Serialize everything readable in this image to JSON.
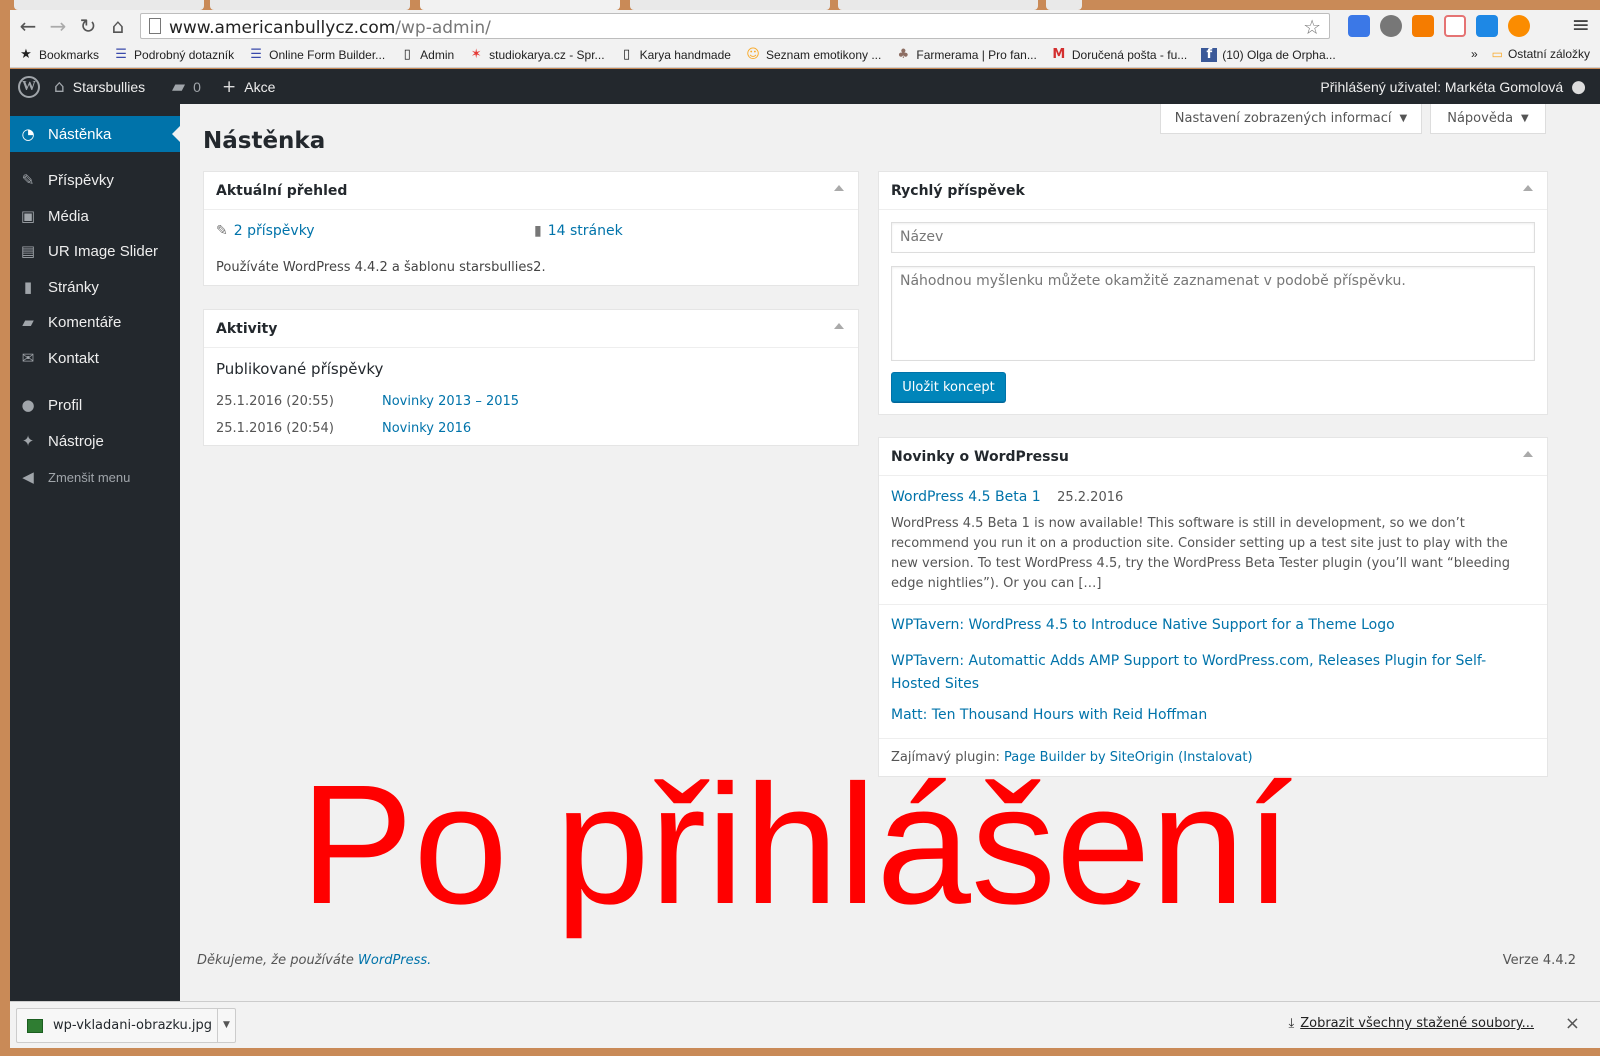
{
  "browser": {
    "url_host": "www.americanbullycz.com",
    "url_path": "/wp-admin/",
    "bookmarks": [
      {
        "label": "Bookmarks",
        "icon": "star-icon"
      },
      {
        "label": "Podrobný dotazník",
        "icon": "form-icon"
      },
      {
        "label": "Online Form Builder...",
        "icon": "form-icon"
      },
      {
        "label": "Admin",
        "icon": "page-icon"
      },
      {
        "label": "studiokarya.cz - Spr...",
        "icon": "joomla-icon"
      },
      {
        "label": "Karya handmade",
        "icon": "page-icon"
      },
      {
        "label": "Seznam emotikony ...",
        "icon": "smiley-icon"
      },
      {
        "label": "Farmerama | Pro fan...",
        "icon": "farm-icon"
      },
      {
        "label": "Doručená pošta - fu...",
        "icon": "gmail-icon"
      },
      {
        "label": "(10) Olga de Orpha...",
        "icon": "facebook-icon"
      }
    ],
    "bookmarks_more": "»",
    "other_bookmarks": "Ostatní záložky"
  },
  "adminbar": {
    "site_name": "Starsbullies",
    "comments_count": "0",
    "new_label": "Akce",
    "user_greeting": "Přihlášený uživatel: Markéta Gomolová"
  },
  "sidebar": {
    "items": [
      {
        "label": "Nástěnka",
        "icon": "dashboard-icon"
      },
      {
        "label": "Příspěvky",
        "icon": "pin-icon"
      },
      {
        "label": "Média",
        "icon": "media-icon"
      },
      {
        "label": "UR Image Slider",
        "icon": "slider-icon"
      },
      {
        "label": "Stránky",
        "icon": "pages-icon"
      },
      {
        "label": "Komentáře",
        "icon": "comments-icon"
      },
      {
        "label": "Kontakt",
        "icon": "mail-icon"
      },
      {
        "label": "Profil",
        "icon": "user-icon"
      },
      {
        "label": "Nástroje",
        "icon": "wrench-icon"
      }
    ],
    "collapse_label": "Zmenšit menu"
  },
  "header": {
    "screen_options": "Nastavení zobrazených informací",
    "help": "Nápověda",
    "title": "Nástěnka"
  },
  "glance": {
    "title": "Aktuální přehled",
    "posts": "2 příspěvky",
    "pages": "14 stránek",
    "version_text": "Používáte WordPress 4.4.2 a šablonu starsbullies2."
  },
  "activity": {
    "title": "Aktivity",
    "subtitle": "Publikované příspěvky",
    "rows": [
      {
        "date": "25.1.2016 (20:55)",
        "title": "Novinky 2013 – 2015"
      },
      {
        "date": "25.1.2016 (20:54)",
        "title": "Novinky 2016"
      }
    ]
  },
  "quickdraft": {
    "title": "Rychlý příspěvek",
    "title_placeholder": "Název",
    "content_placeholder": "Náhodnou myšlenku můžete okamžitě zaznamenat v podobě příspěvku.",
    "save_label": "Uložit koncept"
  },
  "news": {
    "title": "Novinky o WordPressu",
    "main_title": "WordPress 4.5 Beta 1",
    "main_date": "25.2.2016",
    "main_excerpt": "WordPress 4.5 Beta 1 is now available! This software is still in development, so we don’t recommend you run it on a production site. Consider setting up a test site just to play with the new version. To test WordPress 4.5, try the WordPress Beta Tester plugin (you’ll want “bleeding edge nightlies”). Or you can […]",
    "links": [
      "WPTavern: WordPress 4.5 to Introduce Native Support for a Theme Logo",
      "WPTavern: Automattic Adds AMP Support to WordPress.com, Releases Plugin for Self-Hosted Sites",
      "Matt: Ten Thousand Hours with Reid Hoffman"
    ],
    "plugin_prefix": "Zajímavý plugin:",
    "plugin_name": "Page Builder by SiteOrigin",
    "plugin_install": "(Instalovat)"
  },
  "overlay_caption": "Po přihlášení",
  "footer": {
    "thanks_prefix": "Děkujeme, že používáte",
    "thanks_link": "WordPress.",
    "version": "Verze 4.4.2"
  },
  "downloads": {
    "file": "wp-vkladani-obrazku.jpg",
    "show_all": "Zobrazit všechny stažené soubory...",
    "close": "×"
  },
  "colors": {
    "accent": "#0073aa",
    "adminbar": "#23282d",
    "overlay": "#ff0000"
  }
}
